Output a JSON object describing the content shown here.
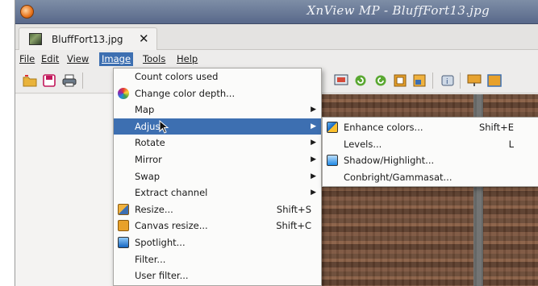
{
  "window": {
    "title": "XnView MP - BluffFort13.jpg"
  },
  "tab": {
    "title": "BluffFort13.jpg",
    "close": "✕"
  },
  "menubar": {
    "file": "File",
    "edit": "Edit",
    "view": "View",
    "image": "Image",
    "tools": "Tools",
    "help": "Help"
  },
  "image_menu": {
    "items": [
      {
        "label": "Count colors used"
      },
      {
        "label": "Change color depth..."
      },
      {
        "label": "Map"
      },
      {
        "label": "Adjust"
      },
      {
        "label": "Rotate"
      },
      {
        "label": "Mirror"
      },
      {
        "label": "Swap"
      },
      {
        "label": "Extract channel"
      },
      {
        "label": "Resize...",
        "shortcut": "Shift+S"
      },
      {
        "label": "Canvas resize...",
        "shortcut": "Shift+C"
      },
      {
        "label": "Spotlight..."
      },
      {
        "label": "Filter..."
      },
      {
        "label": "User filter..."
      }
    ]
  },
  "adjust_submenu": {
    "items": [
      {
        "label": "Enhance colors...",
        "shortcut": "Shift+E"
      },
      {
        "label": "Levels...",
        "shortcut": "L"
      },
      {
        "label": "Shadow/Highlight..."
      },
      {
        "label": "Conbright/Gammasat..."
      }
    ]
  },
  "colors": {
    "accent": "#3d6fb1",
    "titlebar": "#6b7b98"
  }
}
